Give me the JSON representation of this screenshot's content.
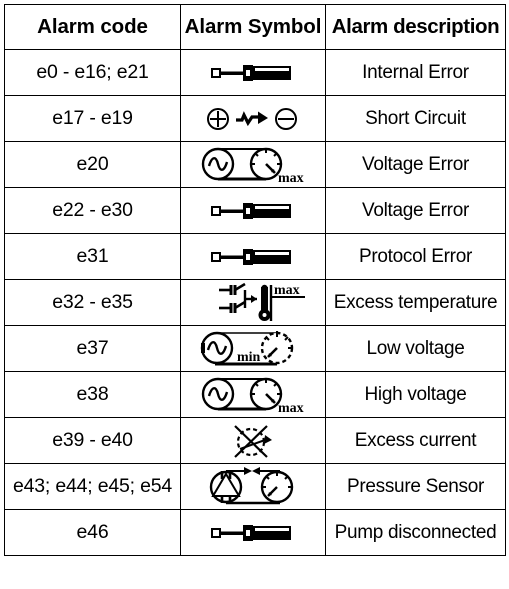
{
  "table": {
    "headers": {
      "code": "Alarm code",
      "symbol": "Alarm Symbol",
      "description": "Alarm description"
    },
    "rows": [
      {
        "code": "e0 - e16;  e21",
        "symbol": "screwdriver-icon",
        "symbol_label": "",
        "description": "Internal Error"
      },
      {
        "code": "e17 - e19",
        "symbol": "short-circuit-icon",
        "symbol_label": "",
        "description": "Short Circuit"
      },
      {
        "code": "e20",
        "symbol": "ac-gauge-max-icon",
        "symbol_label": "max",
        "description": "Voltage Error"
      },
      {
        "code": "e22 - e30",
        "symbol": "screwdriver-icon",
        "symbol_label": "",
        "description": "Voltage Error"
      },
      {
        "code": "e31",
        "symbol": "screwdriver-icon",
        "symbol_label": "",
        "description": "Protocol Error"
      },
      {
        "code": "e32 - e35",
        "symbol": "thermometer-max-icon",
        "symbol_label": "max",
        "description": "Excess temperature"
      },
      {
        "code": "e37",
        "symbol": "ac-gauge-min-icon",
        "symbol_label": "min",
        "description": "Low voltage"
      },
      {
        "code": "e38",
        "symbol": "ac-gauge-max-icon",
        "symbol_label": "max",
        "description": "High voltage"
      },
      {
        "code": "e39 - e40",
        "symbol": "crossed-circle-icon",
        "symbol_label": "",
        "description": "Excess current"
      },
      {
        "code": "e43; e44; e45; e54",
        "symbol": "pump-gauge-icon",
        "symbol_label": "",
        "description": "Pressure Sensor"
      },
      {
        "code": "e46",
        "symbol": "screwdriver-icon",
        "symbol_label": "",
        "description": "Pump disconnected"
      }
    ]
  },
  "colors": {
    "ink": "#000000",
    "background": "#ffffff",
    "border": "#000000"
  }
}
